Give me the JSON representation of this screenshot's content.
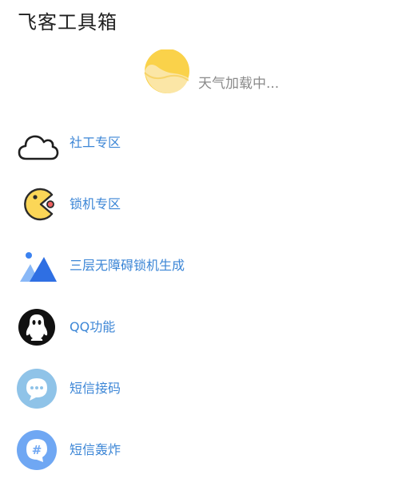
{
  "app": {
    "title": "飞客工具箱"
  },
  "weather": {
    "status_text": "天气加载中...",
    "icon": "sun-icon",
    "icon_colors": {
      "sun": "#fad24a",
      "sun_light": "#fbe6a6"
    }
  },
  "menu": {
    "label_color": "#3c86d6",
    "items": [
      {
        "label": "社工专区",
        "icon": "cloud-icon"
      },
      {
        "label": "锁机专区",
        "icon": "pacman-icon"
      },
      {
        "label": "三层无障碍锁机生成",
        "icon": "image-mountain-icon"
      },
      {
        "label": "QQ功能",
        "icon": "qq-penguin-icon"
      },
      {
        "label": "短信接码",
        "icon": "message-bubble-icon"
      },
      {
        "label": "短信轰炸",
        "icon": "hash-bubble-icon"
      }
    ]
  }
}
